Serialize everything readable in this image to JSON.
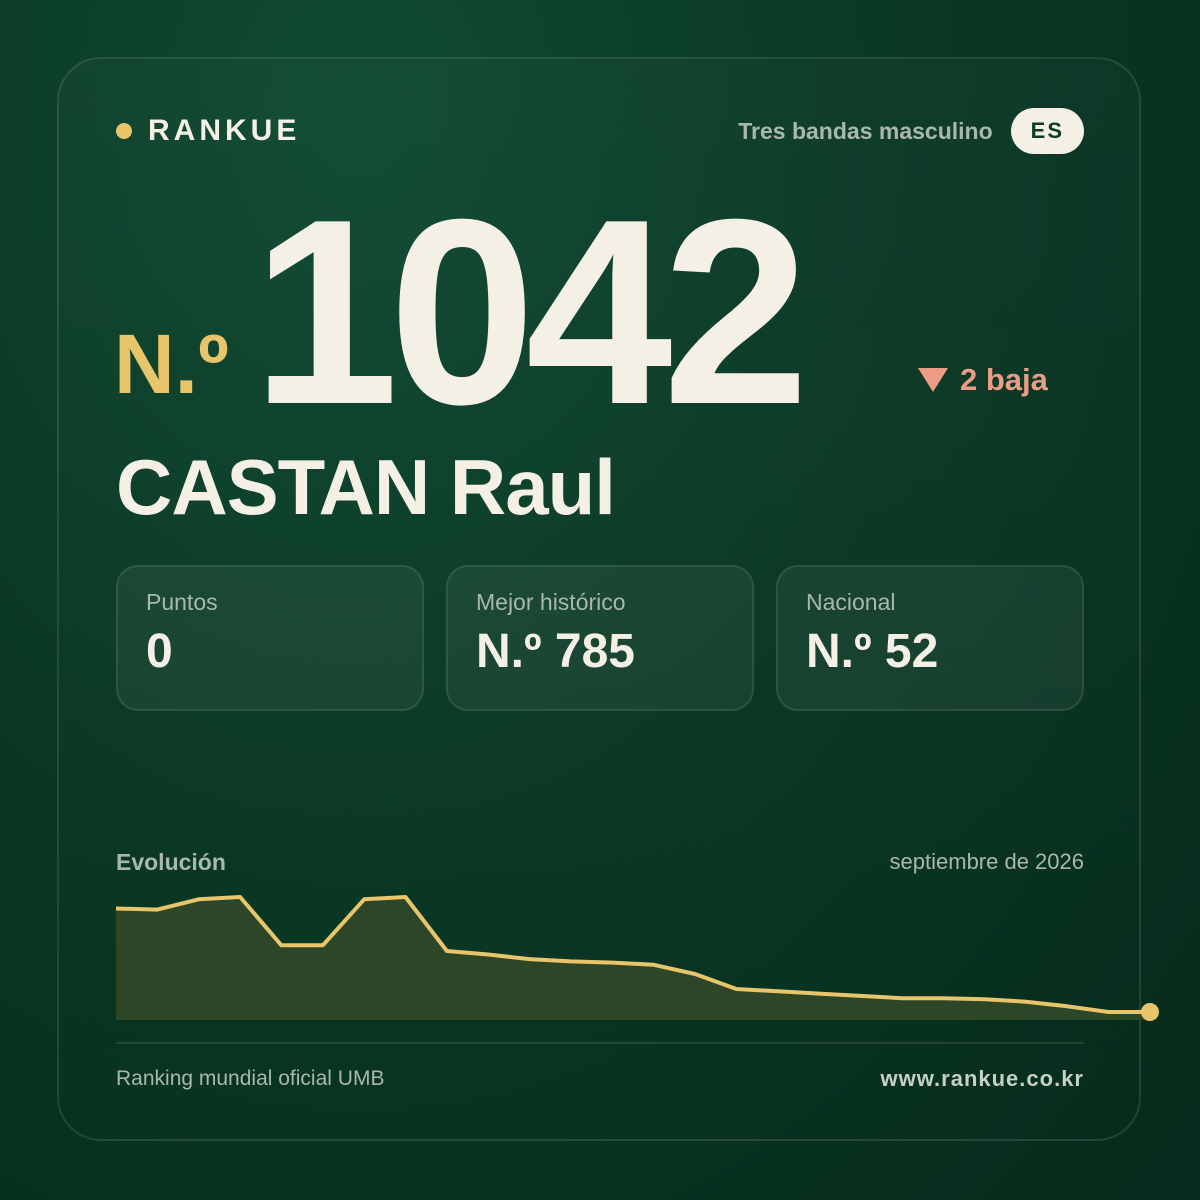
{
  "brand": {
    "name": "RANKUE",
    "dot_color": "#e8c56a"
  },
  "category": {
    "label": "Tres bandas masculino",
    "country": "ES"
  },
  "rank": {
    "prefix": "N.º",
    "value": "1042",
    "change_icon": "triangle-down-icon",
    "change_text": "2 baja",
    "change_color": "#ec9c86"
  },
  "player": {
    "name": "CASTAN Raul"
  },
  "stats": [
    {
      "label": "Puntos",
      "value": "0"
    },
    {
      "label": "Mejor histórico",
      "value": "N.º 785"
    },
    {
      "label": "Nacional",
      "value": "N.º 52"
    }
  ],
  "evolution": {
    "title": "Evolución",
    "date": "septiembre de 2026"
  },
  "chart_data": {
    "type": "area",
    "note_scale": "relative level per sample, higher = better ranking",
    "values": [
      0.9,
      0.89,
      0.98,
      1.0,
      0.58,
      0.58,
      0.98,
      1.0,
      0.53,
      0.5,
      0.46,
      0.44,
      0.43,
      0.41,
      0.33,
      0.2,
      0.18,
      0.16,
      0.14,
      0.12,
      0.12,
      0.11,
      0.09,
      0.05,
      0.0,
      0.0
    ],
    "line_color": "#e8c56a",
    "fill_color": "#2d4628",
    "end_marker": true
  },
  "footer": {
    "left": "Ranking mundial oficial UMB",
    "right": "www.rankue.co.kr"
  }
}
